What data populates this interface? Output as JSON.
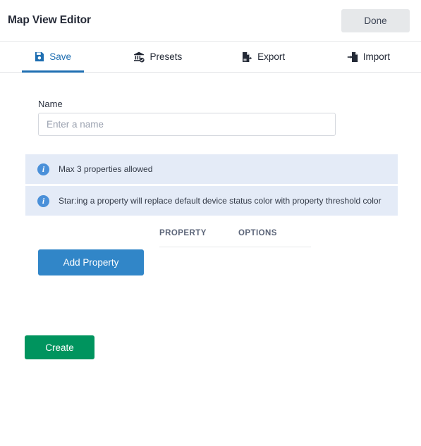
{
  "header": {
    "title": "Map View Editor",
    "done_label": "Done"
  },
  "tabs": [
    {
      "label": "Save",
      "icon": "save-icon",
      "active": true
    },
    {
      "label": "Presets",
      "icon": "presets-icon",
      "active": false
    },
    {
      "label": "Export",
      "icon": "export-icon",
      "active": false
    },
    {
      "label": "Import",
      "icon": "import-icon",
      "active": false
    }
  ],
  "form": {
    "name_label": "Name",
    "name_value": "",
    "name_placeholder": "Enter a name"
  },
  "banners": [
    {
      "icon": "info-icon",
      "glyph": "i",
      "text": "Max 3 properties allowed"
    },
    {
      "icon": "info-icon",
      "glyph": "i",
      "text": "Star:ing a property will replace default device status color with property threshold color"
    }
  ],
  "property_table": {
    "columns": [
      "PROPERTY",
      "OPTIONS"
    ],
    "rows": []
  },
  "actions": {
    "add_property_label": "Add Property",
    "create_label": "Create"
  },
  "colors": {
    "accent_blue": "#1f6fb2",
    "button_blue": "#3186c8",
    "button_green": "#00945e",
    "banner_bg": "#e4ebf7",
    "info_icon": "#4a90d9",
    "done_bg": "#e6e8ea",
    "text_dark": "#242936",
    "text_muted": "#5b6478"
  }
}
